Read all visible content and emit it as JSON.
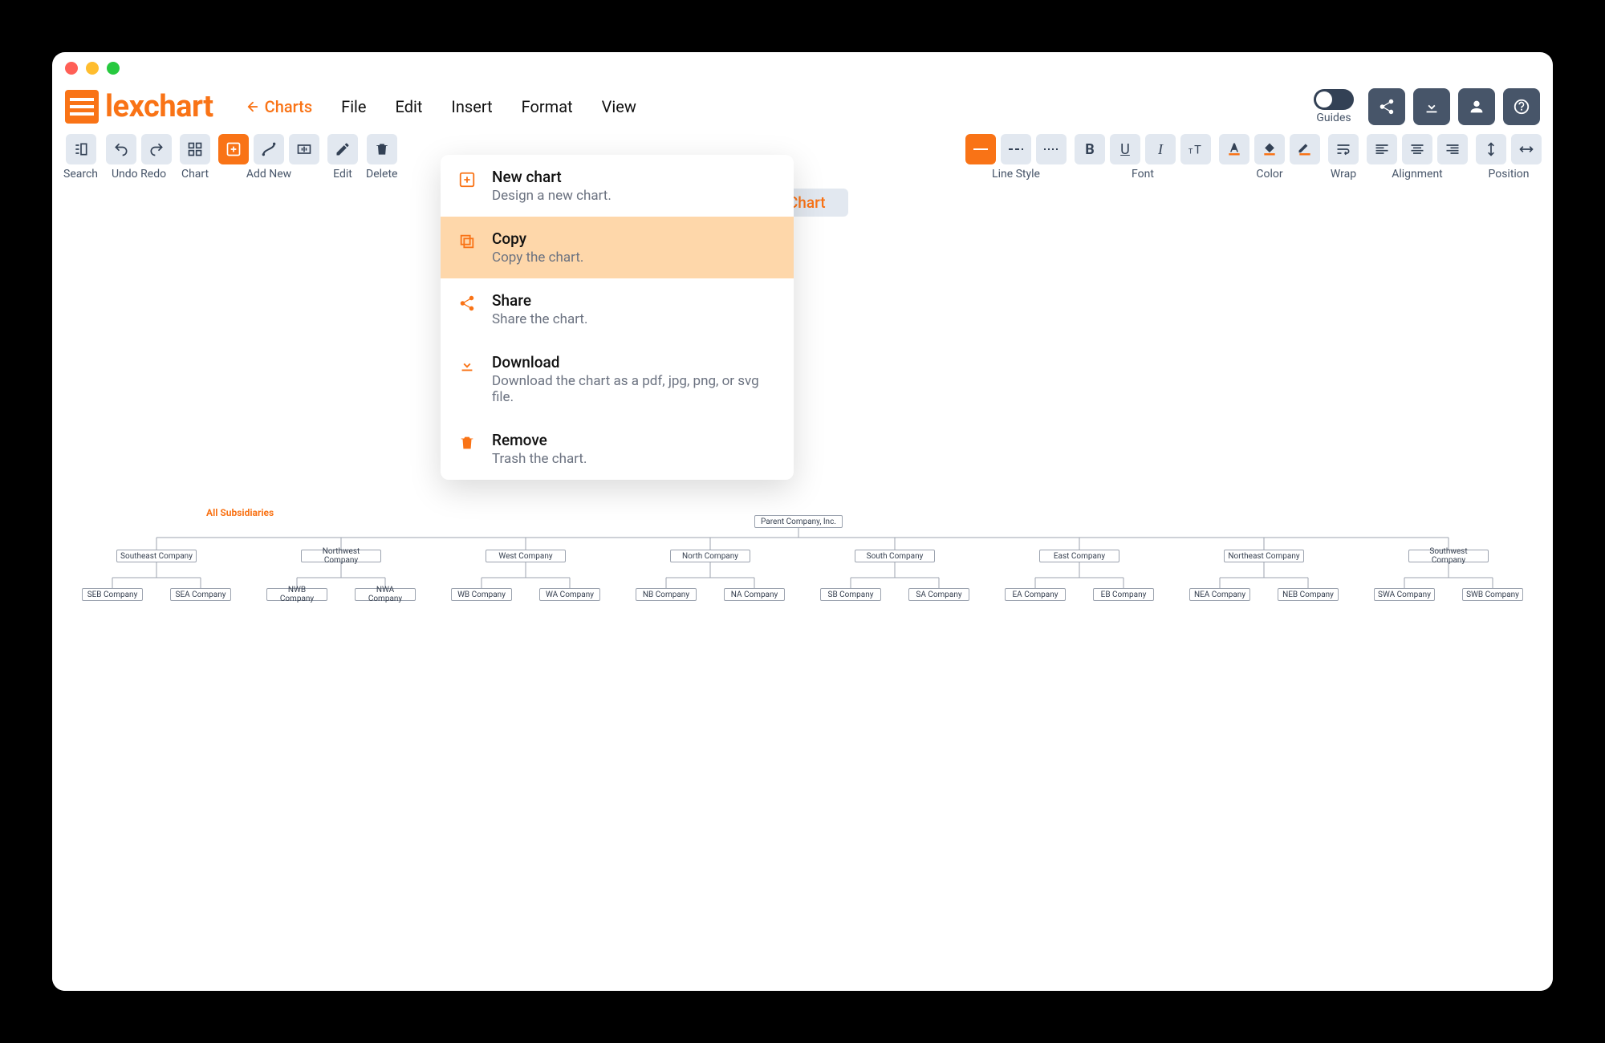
{
  "brand": {
    "name": "lexchart"
  },
  "menubar": {
    "back": "Charts",
    "items": [
      "File",
      "Edit",
      "Insert",
      "Format",
      "View"
    ]
  },
  "guides_label": "Guides",
  "toolbar": {
    "search": "Search",
    "undo": "Undo",
    "redo": "Redo",
    "chart": "Chart",
    "add_new": "Add New",
    "edit": "Edit",
    "delete": "Delete",
    "line_style": "Line Style",
    "font": "Font",
    "color": "Color",
    "wrap": "Wrap",
    "alignment": "Alignment",
    "position": "Position"
  },
  "tab_chip": "e Chart",
  "dropdown": [
    {
      "title": "New chart",
      "desc": "Design a new chart."
    },
    {
      "title": "Copy",
      "desc": "Copy the chart."
    },
    {
      "title": "Share",
      "desc": "Share the chart."
    },
    {
      "title": "Download",
      "desc": "Download the chart as a pdf, jpg, png, or svg file."
    },
    {
      "title": "Remove",
      "desc": "Trash the chart."
    }
  ],
  "chart_data": {
    "type": "org",
    "title": "All Subsidiaries",
    "root": "Parent Company, Inc.",
    "level1": [
      "Southeast Company",
      "Northwest Company",
      "West Company",
      "North Company",
      "South Company",
      "East Company",
      "Northeast Company",
      "Southwest Company"
    ],
    "level2": [
      [
        "SEB Company",
        "SEA Company"
      ],
      [
        "NWB Company",
        "NWA Company"
      ],
      [
        "WB Company",
        "WA Company"
      ],
      [
        "NB Company",
        "NA Company"
      ],
      [
        "SB Company",
        "SA Company"
      ],
      [
        "EA Company",
        "EB Company"
      ],
      [
        "NEA Company",
        "NEB Company"
      ],
      [
        "SWA Company",
        "SWB Company"
      ]
    ]
  }
}
